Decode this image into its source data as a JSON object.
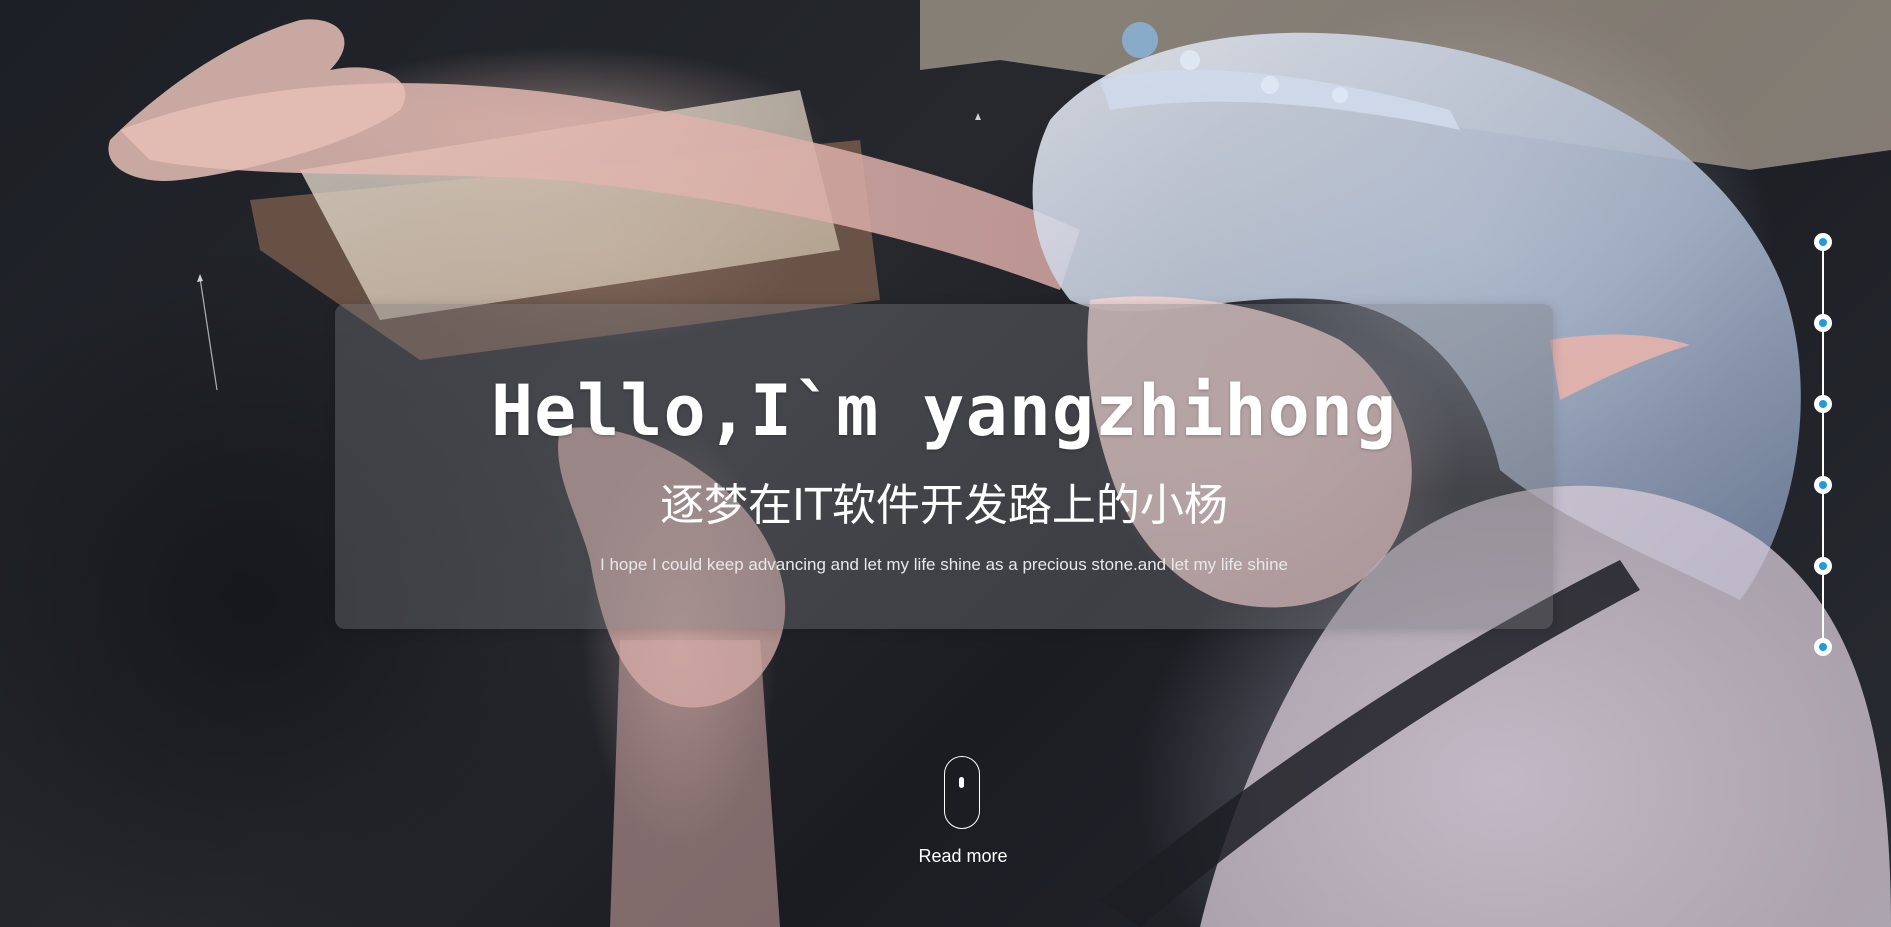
{
  "hero": {
    "title": "Hello,I`m yangzhihong",
    "subtitle": "逐梦在IT软件开发路上的小杨",
    "tagline": "I hope I could keep advancing and let my life shine as a precious stone.and let my life shine"
  },
  "scroll_hint": {
    "icon": "mouse-scroll-icon",
    "label": "Read more"
  },
  "side_nav": {
    "dot_count": 6,
    "accent": "#1e9be0"
  },
  "colors": {
    "panel": "rgba(120,120,125,0.38)",
    "text": "#ffffff",
    "accent": "#1e9be0"
  }
}
